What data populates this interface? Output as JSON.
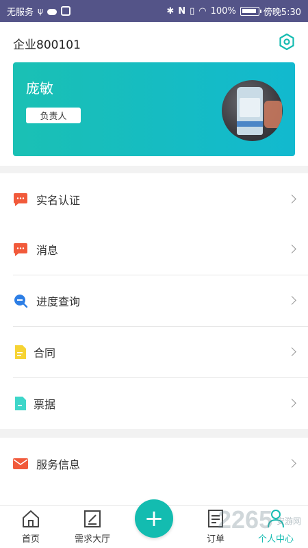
{
  "status_bar": {
    "carrier": "无服务",
    "battery": "100%",
    "time": "傍晚5:30",
    "icons": [
      "usb-icon",
      "cloud-icon",
      "app-icon",
      "bluetooth-icon",
      "nfc-icon",
      "vibrate-icon",
      "wifi-icon",
      "battery-icon"
    ]
  },
  "header": {
    "company": "企业800101",
    "settings_icon": "settings-hexagon-icon"
  },
  "profile": {
    "name": "庞敏",
    "role": "负责人",
    "gradient": [
      "#1ac0b4",
      "#12b9cf"
    ]
  },
  "sections": {
    "verify": {
      "label": "实名认证",
      "icon": "chat-bubble-icon",
      "color": "#f15a3b"
    },
    "messages": {
      "label": "消息",
      "icon": "chat-bubble-icon",
      "color": "#f15a3b"
    },
    "progress": {
      "label": "进度查询",
      "icon": "search-icon",
      "color": "#2d7ee5"
    },
    "contract": {
      "label": "合同",
      "icon": "document-icon",
      "color": "#f6d333"
    },
    "invoice": {
      "label": "票据",
      "icon": "document-icon",
      "color": "#3ed6c9"
    },
    "service": {
      "label": "服务信息",
      "icon": "mail-icon",
      "color": "#f15a3b"
    }
  },
  "bottom_nav": {
    "home": "首页",
    "demand": "需求大厅",
    "add": "+",
    "orders": "订单",
    "me": "个人中心",
    "active_color": "#15bcb1"
  },
  "watermark": {
    "text": "2265",
    "sub": "安游网"
  }
}
